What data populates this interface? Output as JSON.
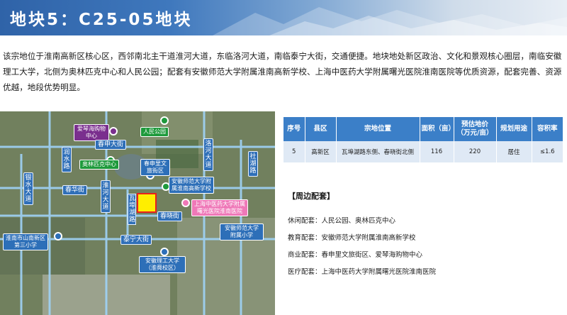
{
  "header": {
    "title": "地块5：C25-05地块"
  },
  "intro": "该宗地位于淮南高新区核心区，西邻南北主干道淮河大道，东临洛河大道，南临泰宁大街，交通便捷。地块地处新区政治、文化和景观核心圈层，南临安徽理工大学，北侧为奥林匹克中心和人民公园；配套有安徽师范大学附属淮南高新学校、上海中医药大学附属曙光医院淮南医院等优质资源，配套完善、资源优越，地段优势明显。",
  "map": {
    "labels": {
      "aiqin": "爱琴海购物中心",
      "people_park": "人民公园",
      "chunshen": "春申大街",
      "luohe": "洛河大道",
      "runshui": "润水路",
      "olympic": "奥林匹克中心",
      "chunshen_culture": "春申里文旅街区",
      "shehu": "社湖路",
      "anhui_normal": "安徽师范大学附属淮南高新学校",
      "huaihe": "淮河大道",
      "chunhua": "春华街",
      "yinshui": "银水大道",
      "site_road": "瓦埠湖路",
      "shanghai_tcm": "上海中医药大学附属曙光医院淮南医院",
      "chunfang": "春晓街",
      "taining": "泰宁大街",
      "huainan_school": "淮南市山南新区第三小学",
      "affil_primary": "安徽师范大学附属小学",
      "aust": "安徽理工大学（淮舜校区）"
    }
  },
  "table": {
    "headers": [
      "序号",
      "县区",
      "宗地位置",
      "面积（亩）",
      "预估地价（万元/亩）",
      "规划用途",
      "容积率"
    ],
    "rows": [
      [
        "5",
        "高新区",
        "瓦埠湖路东侧、春晓街北侧",
        "116",
        "220",
        "居住",
        "≤1.6"
      ]
    ]
  },
  "amenities": {
    "title": "【周边配套】",
    "items": [
      {
        "key": "休闲配套：",
        "value": "人民公园、奥林匹克中心"
      },
      {
        "key": "教育配套：",
        "value": "安徽师范大学附属淮南高新学校"
      },
      {
        "key": "商业配套：",
        "value": "春申里文旅街区、爱琴海购物中心"
      },
      {
        "key": "医疗配套：",
        "value": "上海中医药大学附属曙光医院淮南医院"
      }
    ]
  },
  "colors": {
    "banner": "#3f78bd",
    "table_header": "#3b7fc8",
    "table_row": "#dfe9f5",
    "road": "#2f6fb8",
    "site": "#ffee00"
  }
}
